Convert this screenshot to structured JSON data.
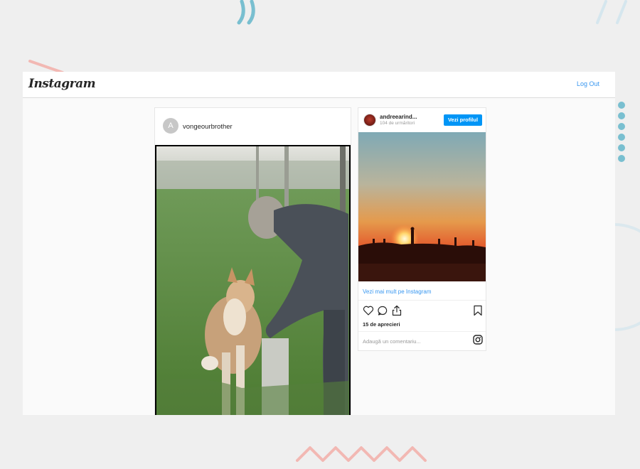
{
  "app": {
    "logo_text": "Instagram",
    "logout_label": "Log Out"
  },
  "post": {
    "avatar_letter": "A",
    "username": "vongeourbrother"
  },
  "embed": {
    "username": "andreearind...",
    "followers": "104 de urmăritori",
    "view_profile_label": "Vezi profilul",
    "see_more_label": "Vezi mai mult pe Instagram",
    "likes": "15 de aprecieri",
    "comment_placeholder": "Adaugă un comentariu..."
  },
  "colors": {
    "accent": "#3897f0",
    "button": "#0095f6",
    "decor_teal": "#79bfd0",
    "decor_pink": "#f2b8b3"
  }
}
